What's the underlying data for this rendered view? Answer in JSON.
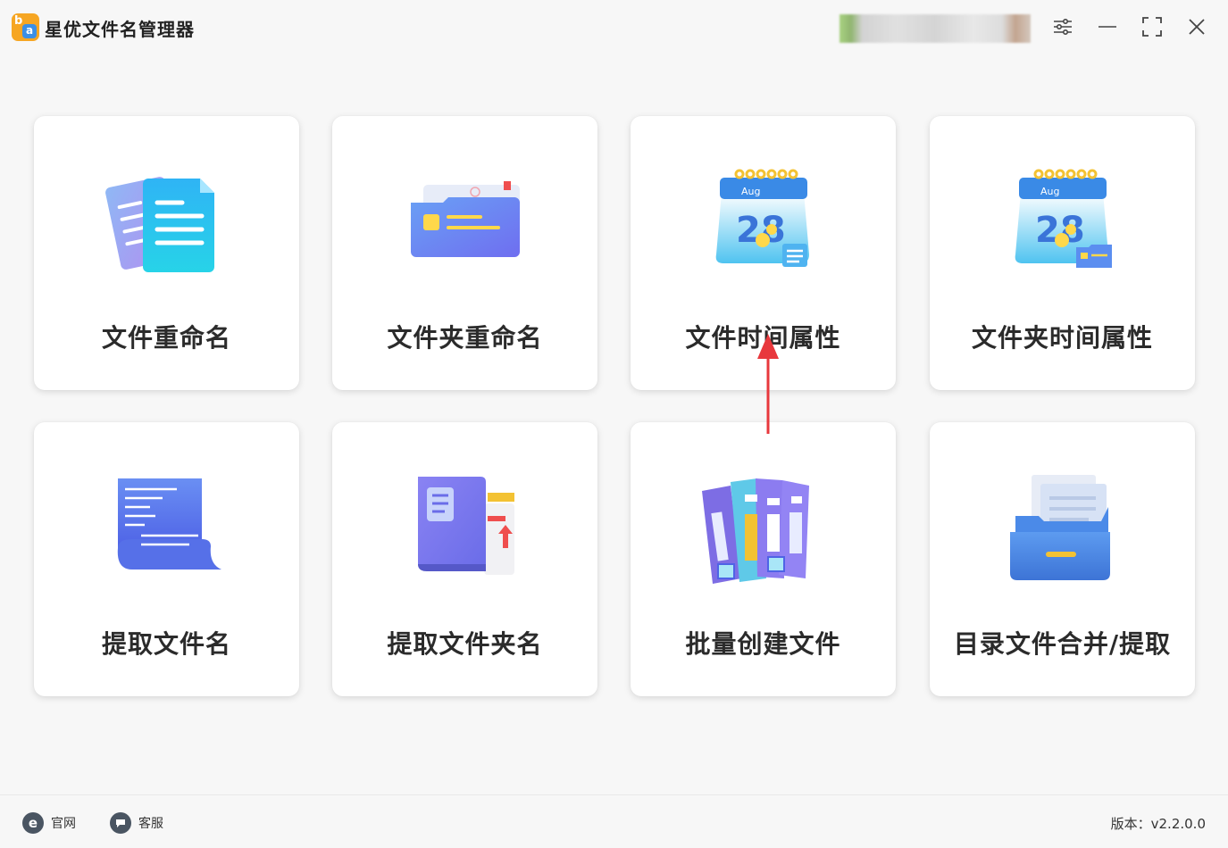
{
  "app": {
    "title": "星优文件名管理器",
    "logo_letters": "ba"
  },
  "window_controls": {
    "settings_icon": "sliders-icon",
    "minimize_icon": "minimize-icon",
    "maximize_icon": "maximize-icon",
    "close_icon": "close-icon"
  },
  "cards": [
    {
      "label": "文件重命名",
      "icon": "documents-icon"
    },
    {
      "label": "文件夹重命名",
      "icon": "folder-icon"
    },
    {
      "label": "文件时间属性",
      "icon": "calendar-file-icon",
      "calendar_month": "Aug",
      "calendar_day": "28"
    },
    {
      "label": "文件夹时间属性",
      "icon": "calendar-folder-icon",
      "calendar_month": "Aug",
      "calendar_day": "28"
    },
    {
      "label": "提取文件名",
      "icon": "scroll-list-icon"
    },
    {
      "label": "提取文件夹名",
      "icon": "book-folder-icon"
    },
    {
      "label": "批量创建文件",
      "icon": "binders-icon"
    },
    {
      "label": "目录文件合并/提取",
      "icon": "open-folder-icon"
    }
  ],
  "footer": {
    "website_label": "官网",
    "website_icon_glyph": "e",
    "support_label": "客服",
    "version_text": "版本：v2.2.0.0"
  },
  "colors": {
    "accent_arrow": "#e8383d",
    "logo_orange": "#f6a623",
    "logo_blue": "#3b8fe6"
  }
}
